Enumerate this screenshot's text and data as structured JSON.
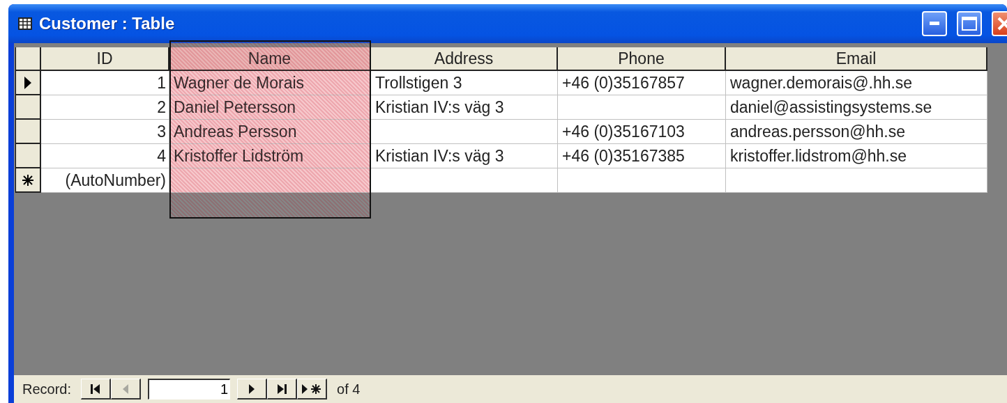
{
  "window": {
    "title": "Customer : Table"
  },
  "table": {
    "columns": [
      {
        "label": "ID",
        "kind": "number",
        "selected": false
      },
      {
        "label": "Name",
        "kind": "text",
        "selected": true
      },
      {
        "label": "Address",
        "kind": "text",
        "selected": false
      },
      {
        "label": "Phone",
        "kind": "text",
        "selected": false
      },
      {
        "label": "Email",
        "kind": "text",
        "selected": false
      }
    ],
    "rows": [
      {
        "kind": "record",
        "current": true,
        "cells": [
          "1",
          "Wagner de Morais",
          "Trollstigen 3",
          "+46 (0)35167857",
          "wagner.demorais@.hh.se"
        ]
      },
      {
        "kind": "record",
        "current": false,
        "cells": [
          "2",
          "Daniel Petersson",
          "Kristian IV:s väg 3",
          null,
          "daniel@assistingsystems.se"
        ]
      },
      {
        "kind": "record",
        "current": false,
        "cells": [
          "3",
          "Andreas Persson",
          null,
          "+46 (0)35167103",
          "andreas.persson@hh.se"
        ]
      },
      {
        "kind": "record",
        "current": false,
        "cells": [
          "4",
          "Kristoffer Lidström",
          "Kristian IV:s väg 3",
          "+46 (0)35167385",
          "kristoffer.lidstrom@hh.se"
        ]
      },
      {
        "kind": "new",
        "current": false,
        "cells": [
          "(AutoNumber)",
          null,
          null,
          null,
          null
        ]
      }
    ]
  },
  "navigator": {
    "label": "Record:",
    "current": "1",
    "total": "of 4",
    "buttons": [
      {
        "kind": "first",
        "disabled": false
      },
      {
        "kind": "prev",
        "disabled": true
      },
      {
        "kind": "next",
        "disabled": false
      },
      {
        "kind": "last",
        "disabled": false
      },
      {
        "kind": "new",
        "disabled": false
      }
    ]
  }
}
